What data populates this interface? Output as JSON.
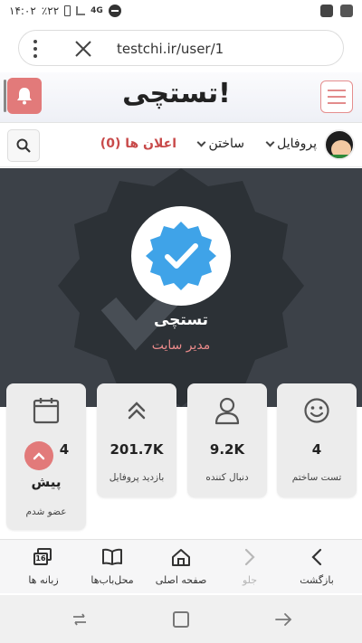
{
  "status_bar": {
    "time": "۱۴:۰۲",
    "battery": "٪۲۲",
    "network": "4G"
  },
  "browser": {
    "url": "testchi.ir/user/1"
  },
  "site": {
    "logo_text": "تستچی!"
  },
  "nav": {
    "profile_label": "پروفایل",
    "build_label": "ساختن",
    "notifications_label": "اعلان ها (0)"
  },
  "profile": {
    "name": "تستچی",
    "role": "مدیر سایت"
  },
  "stats": [
    {
      "icon": "smile-icon",
      "value": "4",
      "label": "تست ساختم"
    },
    {
      "icon": "user-icon",
      "value": "9.2K",
      "label": "دنبال کننده"
    },
    {
      "icon": "double-chevron-up-icon",
      "value": "201.7K",
      "label": "بازدید پروفایل"
    },
    {
      "icon": "calendar-icon",
      "value": "4",
      "since": "پیش",
      "label": "عضو شدم"
    }
  ],
  "toolbar": {
    "back_label": "بازگشت",
    "forward_label": "جلو",
    "home_label": "صفحه اصلی",
    "bookmarks_label": "محل‌باب‌ها",
    "tabs_label": "زبانه ها",
    "tabs_count": "16"
  },
  "colors": {
    "accent": "#e27a7a",
    "hero_bg": "#3c4148",
    "verified_blue": "#3fa3e8"
  }
}
